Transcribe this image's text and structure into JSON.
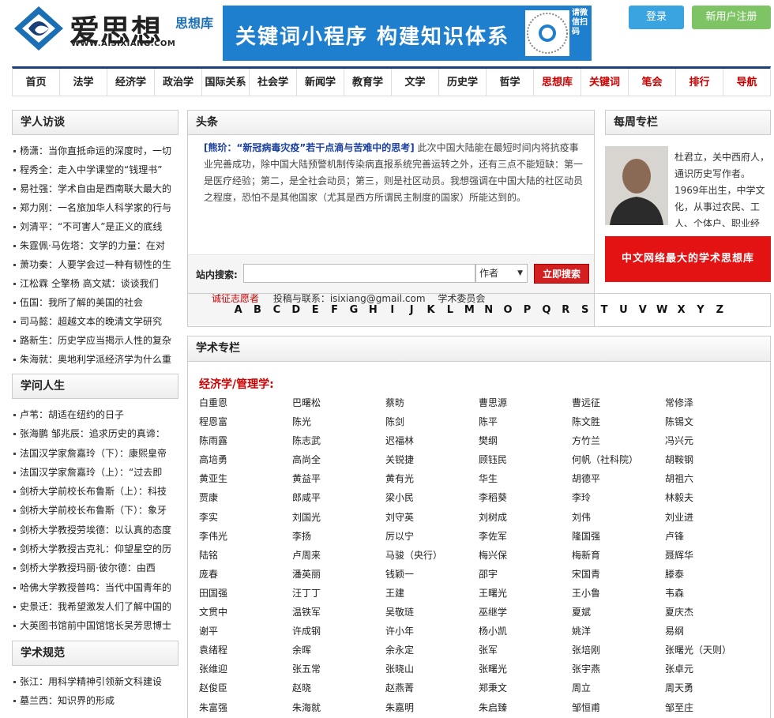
{
  "header": {
    "logo_cn": "爱思想",
    "logo_sub": "思想库",
    "logo_url": "WWW.AISIXIANG.COM",
    "banner_text": "关键词小程序  构建知识体系",
    "banner_qr_label": "请微信扫码",
    "login": "登录",
    "register": "新用户注册"
  },
  "nav": [
    "首页",
    "法学",
    "经济学",
    "政治学",
    "国际关系",
    "社会学",
    "新闻学",
    "教育学",
    "文学",
    "历史学",
    "哲学",
    "思想库",
    "关键词",
    "笔会",
    "排行",
    "导航"
  ],
  "left": {
    "sec1_title": "学人访谈",
    "sec1_items": [
      "杨潇：当你直抵命运的深度时，一切",
      "程秀全：走入中学课堂的“钱理书”",
      "易社强：学术自由是西南联大最大的",
      "郑力刚：一名旅加华人科学家的行与",
      "刘清平：“不可害人”是正义的底线",
      "朱霆佩·马佐塔：文学的力量：在对",
      "萧功秦：人要学会过一种有韧性的生",
      "江松霖 仝擎杨 高文斌：谈谈我们",
      "伍国：我所了解的美国的社会",
      "司马懿：超越文本的晚清文学研究",
      "路新生：历史学应当揭示人性的复杂",
      "朱海就：奥地利学派经济学为什么重"
    ],
    "sec2_title": "学问人生",
    "sec2_items": [
      "卢苇：胡适在纽约的日子",
      "张海鹏 邹兆辰：追求历史的真谛：",
      "法国汉学家詹嘉玲（下）：康熙皇帝",
      "法国汉学家詹嘉玲（上）：“过去即",
      "剑桥大学前校长布鲁斯（上）：科技",
      "剑桥大学前校长布鲁斯（下）：象牙",
      "剑桥大学教授劳埃德：以认真的态度",
      "剑桥大学教授古克礼：仰望星空的历",
      "剑桥大学教授玛丽·彼尔德：由西",
      "哈佛大学教授普鸣：当代中国青年的",
      "史景迁：我希望激发人们了解中国的",
      "大英图书馆前中国馆馆长吴芳思博士"
    ],
    "sec3_title": "学术规范",
    "sec3_items": [
      "张江：用科学精神引领新文科建设",
      "墓兰西：知识界的形成"
    ]
  },
  "headline": {
    "title": "头条",
    "link": "[熊玠：“新冠病毒灾疫”若干点滴与苦难中的思考]",
    "body": " 此次中国大陆能在最短时间内将抗疫事业完善成功，除中国大陆预警机制传染病直报系统完善运转之外，还有三点不能短缺：第一是医疗经验；第二，是全社会动员；第三，则是社区动员。我想强调在中国大陆的社区动员之程度，恐怕不是其他国家（尤其是西方所谓民主制度的国家）所能达到的。",
    "search_label": "站内搜索:",
    "search_value": "",
    "search_select": "作者",
    "search_button": "立即搜索",
    "link_recruit": "诚征志愿者",
    "link_contact": "投稿与联系：isixiang@gmail.com",
    "link_committee": "学术委员会"
  },
  "alphabet": [
    "A",
    "B",
    "C",
    "D",
    "E",
    "F",
    "G",
    "H",
    "I",
    "J",
    "K",
    "L",
    "M",
    "N",
    "O",
    "P",
    "Q",
    "R",
    "S",
    "T",
    "U",
    "V",
    "W",
    "X",
    "Y",
    "Z"
  ],
  "columns": {
    "title": "学术专栏",
    "category": "经济学/管理学:",
    "names": [
      "白重恩",
      "巴曙松",
      "蔡昉",
      "曹思源",
      "曹远征",
      "常修泽",
      "程恩富",
      "陈光",
      "陈剑",
      "陈平",
      "陈文胜",
      "陈锡文",
      "陈雨露",
      "陈志武",
      "迟福林",
      "樊纲",
      "方竹兰",
      "冯兴元",
      "高培勇",
      "高尚全",
      "关锐捷",
      "顾钰民",
      "何帆（社科院）",
      "胡鞍钢",
      "黄亚生",
      "黄益平",
      "黄有光",
      "华生",
      "胡德平",
      "胡祖六",
      "贾康",
      "郎咸平",
      "梁小民",
      "李稻葵",
      "李玲",
      "林毅夫",
      "李实",
      "刘国光",
      "刘守英",
      "刘树成",
      "刘伟",
      "刘业进",
      "李伟光",
      "李扬",
      "厉以宁",
      "李佐军",
      "隆国强",
      "卢锋",
      "陆铭",
      "卢周来",
      "马骏（央行）",
      "梅兴保",
      "梅新育",
      "聂辉华",
      "庞春",
      "潘英丽",
      "钱颖一",
      "邵宇",
      "宋国青",
      "滕泰",
      "田国强",
      "汪丁丁",
      "王建",
      "王曙光",
      "王小鲁",
      "韦森",
      "文贯中",
      "温铁军",
      "吴敬琏",
      "巫继学",
      "夏斌",
      "夏庆杰",
      "谢平",
      "许成钢",
      "许小年",
      "杨小凯",
      "姚洋",
      "易纲",
      "袁绪程",
      "余晖",
      "余永定",
      "张军",
      "张培刚",
      "张曙光（天则）",
      "张维迎",
      "张五常",
      "张晓山",
      "张曙光",
      "张宇燕",
      "张卓元",
      "赵俊臣",
      "赵晓",
      "赵燕菁",
      "郑秉文",
      "周立",
      "周天勇",
      "朱富强",
      "朱海就",
      "朱嘉明",
      "朱启臻",
      "邹恒甫",
      "邹至庄"
    ]
  },
  "right": {
    "title": "每周专栏",
    "author_text": "杜君立，关中西府人，通识历史写作者。1969年出生，中学文化，从事过农民、工人、个体户、职业经",
    "banner": "中文网络最大的学术思想库"
  },
  "colors": {
    "nav_border": "#1a3f78",
    "red": "#c00",
    "banner_blue": "#1f7fcf",
    "login_blue": "#3aa4e0",
    "register_green": "#7ec464"
  }
}
